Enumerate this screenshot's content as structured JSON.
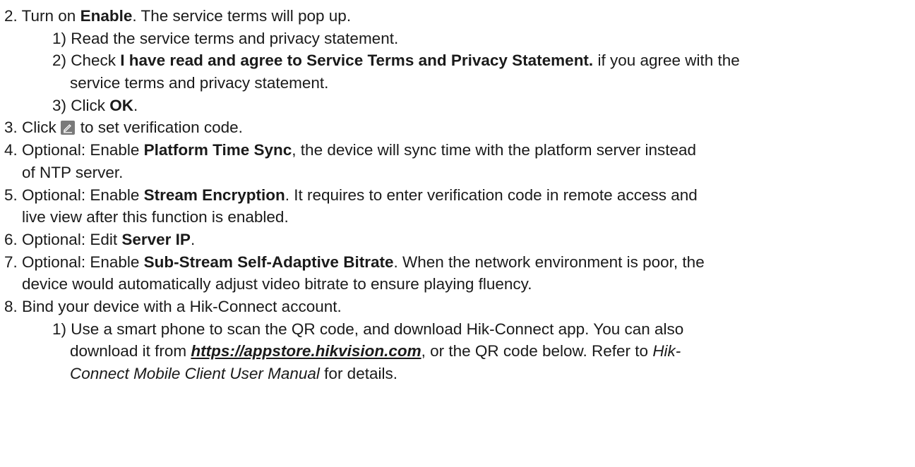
{
  "steps": {
    "s2": {
      "pre": "2. Turn on ",
      "b1": "Enable",
      "post": ". The service terms will pop up."
    },
    "s2_1": {
      "text": "1) Read the service terms and privacy statement."
    },
    "s2_2": {
      "pre": "2) Check ",
      "b1": "I have read and agree to Service Terms and Privacy Statement.",
      "post": " if you agree with the",
      "cont": "service terms and privacy statement."
    },
    "s2_3": {
      "pre": "3) Click ",
      "b1": "OK",
      "post": "."
    },
    "s3": {
      "pre": "3. Click",
      "post": "to set verification code.",
      "icon": "edit-icon"
    },
    "s4": {
      "pre": "4. Optional: Enable ",
      "b1": "Platform Time Sync",
      "post": ", the device will sync time with the platform server instead",
      "cont": "of NTP server."
    },
    "s5": {
      "pre": "5. Optional: Enable ",
      "b1": "Stream Encryption",
      "post": ". It requires to enter verification code in remote access and",
      "cont": "live view after this function is enabled."
    },
    "s6": {
      "pre": "6. Optional: Edit ",
      "b1": "Server IP",
      "post": "."
    },
    "s7": {
      "pre": "7. Optional: Enable ",
      "b1": "Sub-Stream Self-Adaptive Bitrate",
      "post": ". When the network environment is poor, the",
      "cont": "device would automatically adjust video bitrate to ensure playing fluency."
    },
    "s8": {
      "text": "8. Bind your device with a Hik-Connect account."
    },
    "s8_1": {
      "line1": "1) Use a smart phone to scan the QR code, and download Hik-Connect app. You can also",
      "pre2": "download it from ",
      "link": "https://appstore.hikvision.com",
      "post2": ", or the QR code below. Refer to ",
      "italic1": "Hik-",
      "italic2": "Connect Mobile Client User Manual",
      "post3": " for details."
    }
  }
}
